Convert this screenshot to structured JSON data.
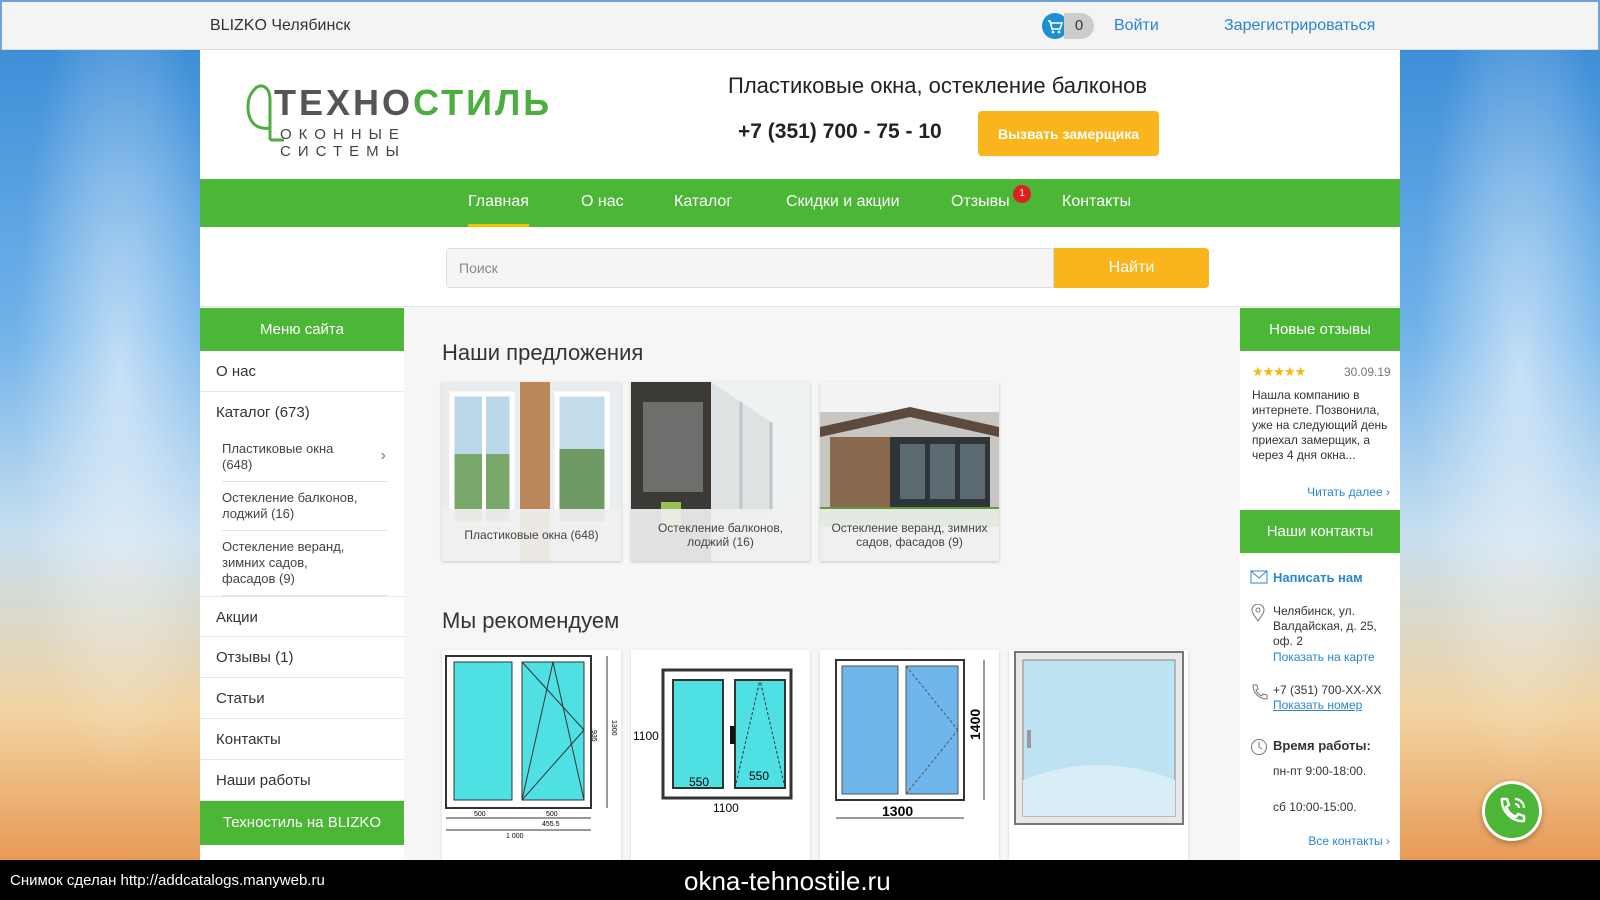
{
  "topbar": {
    "city": "BLIZKO Челябинск",
    "cart_count": "0",
    "login": "Войти",
    "register": "Зарегистрироваться"
  },
  "header": {
    "logo_main_a": "ТЕХНО",
    "logo_main_b": "СТИЛЬ",
    "logo_sub": "ОКОННЫЕ СИСТЕМЫ",
    "tagline": "Пластиковые окна, остекление балконов",
    "phone": "+7 (351) 700 - 75 - 10",
    "call_button": "Вызвать замерщика"
  },
  "nav": {
    "items": [
      {
        "label": "Главная"
      },
      {
        "label": "О нас"
      },
      {
        "label": "Каталог"
      },
      {
        "label": "Скидки и акции"
      },
      {
        "label": "Отзывы",
        "badge": "1"
      },
      {
        "label": "Контакты"
      }
    ]
  },
  "search": {
    "placeholder": "Поиск",
    "button": "Найти"
  },
  "left_menu": {
    "title": "Меню сайта",
    "items": [
      "О нас",
      "Каталог (673)",
      "Акции",
      "Отзывы (1)",
      "Статьи",
      "Контакты",
      "Наши работы"
    ],
    "sub_items": [
      "Пластиковые окна (648)",
      "Остекление балконов, лоджий (16)",
      "Остекление веранд, зимних садов, фасадов (9)"
    ],
    "footer": "Техностиль на BLIZKO"
  },
  "main": {
    "offers_title": "Наши предложения",
    "offers": [
      "Пластиковые окна (648)",
      "Остекление балконов, лоджий (16)",
      "Остекление веранд, зимних садов, фасадов (9)"
    ],
    "recommend_title": "Мы рекомендуем",
    "dims": {
      "d1": [
        "935",
        "1300",
        "500",
        "500",
        "455.5",
        "1 000"
      ],
      "d2": [
        "1100",
        "550",
        "550",
        "1100"
      ],
      "d3": [
        "1400",
        "1300"
      ]
    }
  },
  "right": {
    "reviews_title": "Новые отзывы",
    "review_stars": "★★★★★",
    "review_date": "30.09.19",
    "review_text": "Нашла компанию в интернете. Позвонила, уже на следующий день приехал замерщик, а через 4 дня окна...",
    "read_more": "Читать далее ›",
    "contacts_title": "Наши контакты",
    "write_us": "Написать нам",
    "address": "Челябинск, ул. Валдайская, д. 25, оф. 2",
    "show_map": "Показать на карте",
    "phone": "+7 (351) 700-XX-XX",
    "show_number": "Показать номер",
    "hours_title": "Время работы:",
    "hours_weekdays": "пн-пт 9:00-18:00.",
    "hours_sat": "сб 10:00-15:00.",
    "all_contacts": "Все контакты ›"
  },
  "bottom": {
    "credit": "Снимок сделан http://addcatalogs.manyweb.ru",
    "domain": "okna-tehnostile.ru"
  },
  "colors": {
    "green": "#4cb637",
    "yellow": "#fab51c",
    "link": "#2a85d0",
    "badge": "#e02020"
  }
}
